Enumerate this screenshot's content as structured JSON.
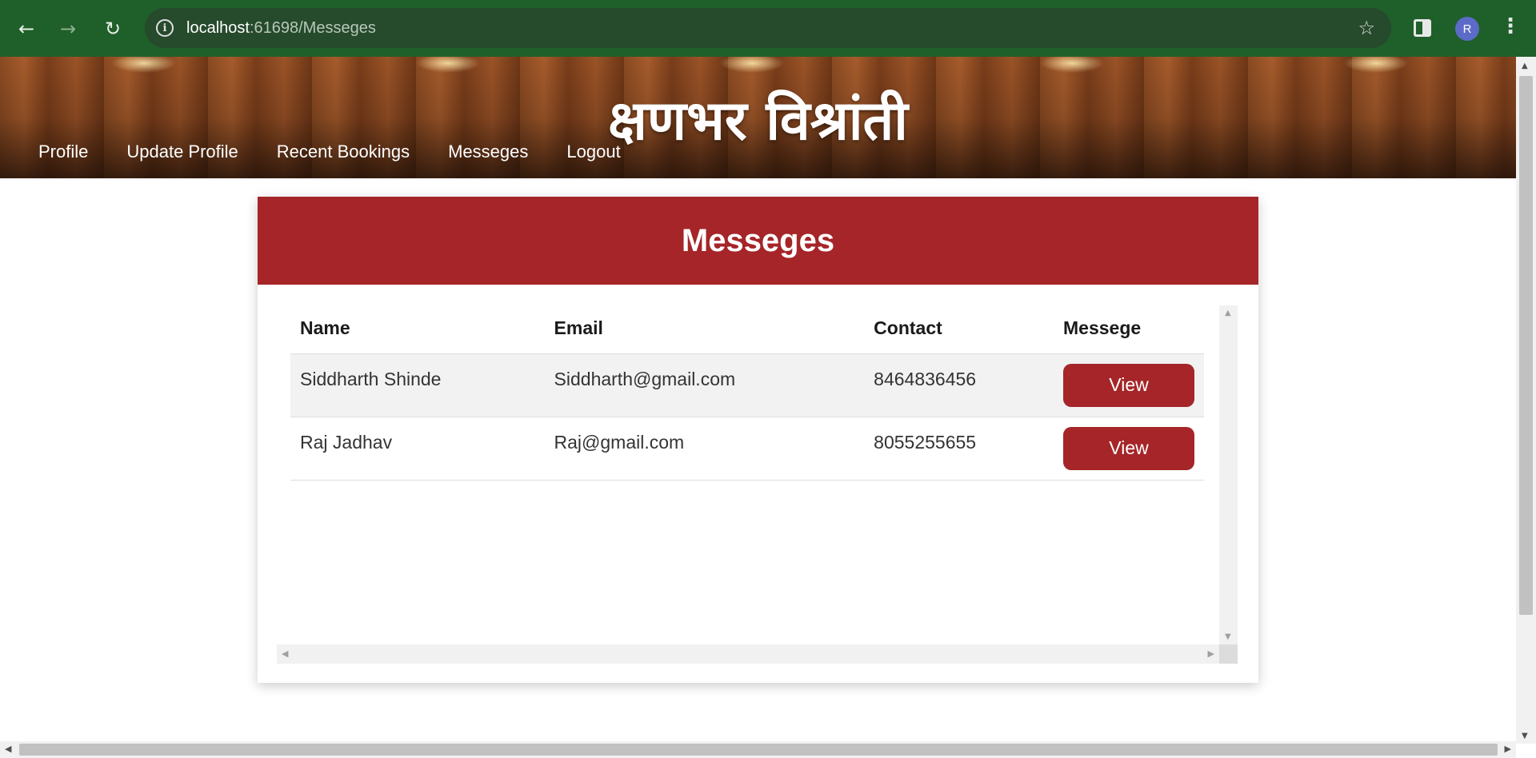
{
  "browser": {
    "url_host": "localhost",
    "url_path": ":61698/Messeges",
    "avatar_letter": "R"
  },
  "site": {
    "title": "क्षणभर विश्रांती",
    "nav": [
      "Profile",
      "Update Profile",
      "Recent Bookings",
      "Messeges",
      "Logout"
    ]
  },
  "card": {
    "title": "Messeges",
    "columns": [
      "Name",
      "Email",
      "Contact",
      "Messege"
    ],
    "rows": [
      {
        "name": "Siddharth Shinde",
        "email": "Siddharth@gmail.com",
        "contact": "8464836456",
        "action": "View"
      },
      {
        "name": "Raj Jadhav",
        "email": "Raj@gmail.com",
        "contact": "8055255655",
        "action": "View"
      }
    ]
  },
  "colors": {
    "accent": "#a52528",
    "browser_bar": "#1f5f2a"
  },
  "icons": [
    "back-arrow-icon",
    "forward-arrow-icon",
    "reload-icon",
    "info-icon",
    "star-icon",
    "side-panel-icon",
    "menu-dots-icon"
  ]
}
